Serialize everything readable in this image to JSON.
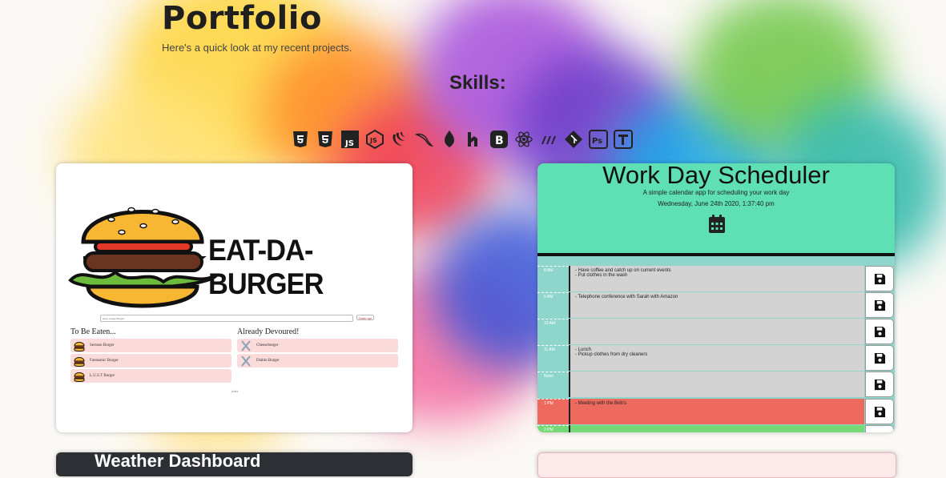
{
  "header": {
    "title": "Portfolio",
    "subtitle": "Here's a quick look at my recent projects.",
    "skills_heading": "Skills:"
  },
  "skills": [
    {
      "icon": "html5-icon"
    },
    {
      "icon": "css3-icon"
    },
    {
      "icon": "javascript-icon"
    },
    {
      "icon": "nodejs-icon"
    },
    {
      "icon": "jquery-icon"
    },
    {
      "icon": "mysql-icon"
    },
    {
      "icon": "mongodb-icon"
    },
    {
      "icon": "handlebars-icon"
    },
    {
      "icon": "bootstrap-icon"
    },
    {
      "icon": "react-icon"
    },
    {
      "icon": "materialize-icon"
    },
    {
      "icon": "git-icon"
    },
    {
      "icon": "photoshop-icon"
    },
    {
      "icon": "illustrator-icon"
    }
  ],
  "burger": {
    "title": "EAT-DA-BURGER",
    "input_placeholder": "Have a tasty Burger!",
    "button_label": "Order up!",
    "to_be_eaten_title": "To Be Eaten...",
    "devoured_title": "Already Devoured!",
    "to_be_eaten": [
      "Serrano Burger",
      "Fantasmic Burger",
      "L.U.S.T Burger"
    ],
    "devoured": [
      "Cheeseburger",
      "Diablo Burger"
    ],
    "footer": "plats"
  },
  "scheduler": {
    "title": "Work Day Scheduler",
    "subtitle": "A simple calendar app for scheduling your work day",
    "date": "Wednesday, June 24th 2020, 1:37:40 pm",
    "hours": [
      {
        "label": "8 AM",
        "text": "- Have coffee and catch up on current events\n- Put clothes in the wash",
        "state": "past"
      },
      {
        "label": "9 AM",
        "text": "- Telephone conference with Sarah with Amazon",
        "state": "past"
      },
      {
        "label": "10 AM",
        "text": "",
        "state": "past"
      },
      {
        "label": "11 AM",
        "text": "- Lunch\n- Pickup clothes from dry cleaners",
        "state": "past"
      },
      {
        "label": "Noon",
        "text": "",
        "state": "past"
      },
      {
        "label": "1 PM",
        "text": "- Meeting with the Bob's",
        "state": "present"
      },
      {
        "label": "2 PM",
        "text": "",
        "state": "future"
      }
    ]
  },
  "weather": {
    "title": "Weather Dashboard"
  },
  "colors": {
    "scheduler_header": "#5ee0b4",
    "present": "#ee6a5f",
    "future": "#75d978",
    "past": "#d3d3d3",
    "burger_item": "#fbdada"
  }
}
